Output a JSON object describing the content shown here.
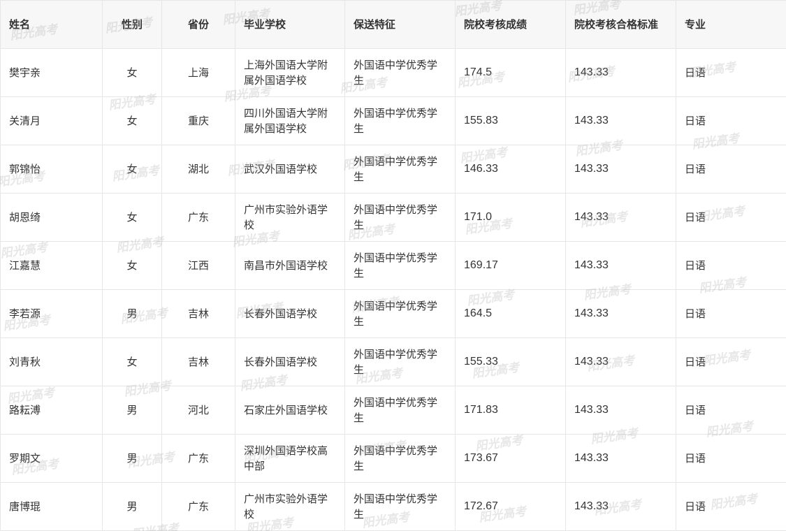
{
  "table": {
    "headers": {
      "name": "姓名",
      "gender": "性别",
      "province": "省份",
      "school": "毕业学校",
      "feature": "保送特征",
      "score": "院校考核成绩",
      "standard": "院校考核合格标准",
      "major": "专业"
    },
    "rows": [
      {
        "name": "樊宇亲",
        "gender": "女",
        "province": "上海",
        "school": "上海外国语大学附属外国语学校",
        "feature": "外国语中学优秀学生",
        "score": "174.5",
        "standard": "143.33",
        "major": "日语"
      },
      {
        "name": "关清月",
        "gender": "女",
        "province": "重庆",
        "school": "四川外国语大学附属外国语学校",
        "feature": "外国语中学优秀学生",
        "score": "155.83",
        "standard": "143.33",
        "major": "日语"
      },
      {
        "name": "郭锦怡",
        "gender": "女",
        "province": "湖北",
        "school": "武汉外国语学校",
        "feature": "外国语中学优秀学生",
        "score": "146.33",
        "standard": "143.33",
        "major": "日语"
      },
      {
        "name": "胡恩绮",
        "gender": "女",
        "province": "广东",
        "school": "广州市实验外语学校",
        "feature": "外国语中学优秀学生",
        "score": "171.0",
        "standard": "143.33",
        "major": "日语"
      },
      {
        "name": "江嘉慧",
        "gender": "女",
        "province": "江西",
        "school": "南昌市外国语学校",
        "feature": "外国语中学优秀学生",
        "score": "169.17",
        "standard": "143.33",
        "major": "日语"
      },
      {
        "name": "李若源",
        "gender": "男",
        "province": "吉林",
        "school": "长春外国语学校",
        "feature": "外国语中学优秀学生",
        "score": "164.5",
        "standard": "143.33",
        "major": "日语"
      },
      {
        "name": "刘青秋",
        "gender": "女",
        "province": "吉林",
        "school": "长春外国语学校",
        "feature": "外国语中学优秀学生",
        "score": "155.33",
        "standard": "143.33",
        "major": "日语"
      },
      {
        "name": "路耘溥",
        "gender": "男",
        "province": "河北",
        "school": "石家庄外国语学校",
        "feature": "外国语中学优秀学生",
        "score": "171.83",
        "standard": "143.33",
        "major": "日语"
      },
      {
        "name": "罗期文",
        "gender": "男",
        "province": "广东",
        "school": "深圳外国语学校高中部",
        "feature": "外国语中学优秀学生",
        "score": "173.67",
        "standard": "143.33",
        "major": "日语"
      },
      {
        "name": "唐博琨",
        "gender": "男",
        "province": "广东",
        "school": "广州市实验外语学校",
        "feature": "外国语中学优秀学生",
        "score": "172.67",
        "standard": "143.33",
        "major": "日语"
      }
    ]
  },
  "watermark": {
    "text": "阳光高考",
    "color": "#a0a0a0"
  }
}
